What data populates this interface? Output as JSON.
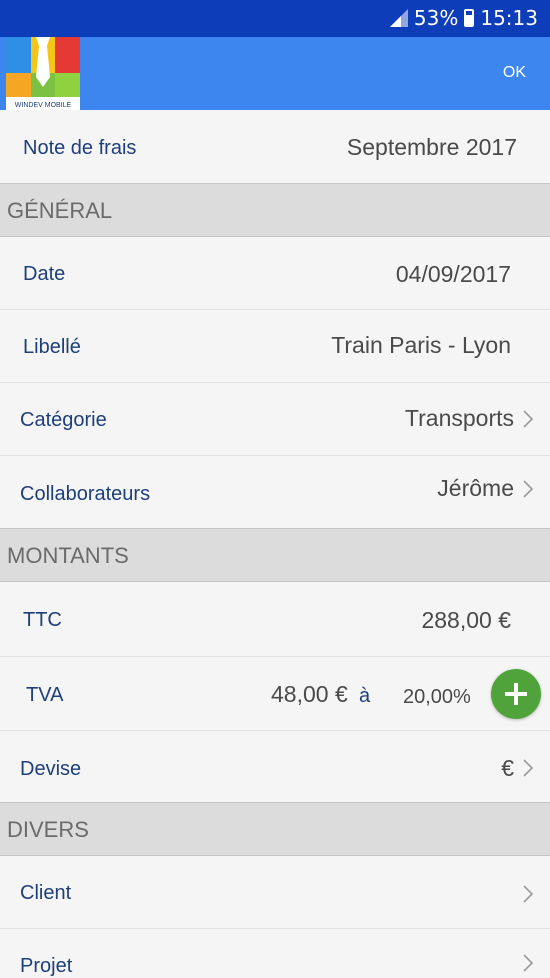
{
  "status_bar": {
    "battery_percent": "53%",
    "time": "15:13"
  },
  "app_bar": {
    "logo_caption": "WINDEV MOBILE",
    "ok_label": "OK"
  },
  "header_row": {
    "label": "Note de frais",
    "value": "Septembre 2017"
  },
  "sections": {
    "general": "GÉNÉRAL",
    "montants": "MONTANTS",
    "divers": "DIVERS"
  },
  "general": {
    "date": {
      "label": "Date",
      "value": "04/09/2017"
    },
    "libelle": {
      "label": "Libellé",
      "value": "Train Paris - Lyon"
    },
    "categorie": {
      "label": "Catégorie",
      "value": "Transports"
    },
    "collaborateurs": {
      "label": "Collaborateurs",
      "value": "Jérôme"
    }
  },
  "montants": {
    "ttc": {
      "label": "TTC",
      "value": "288,00 €"
    },
    "tva": {
      "label": "TVA",
      "amount": "48,00 €",
      "connector": "à",
      "rate": "20,00%"
    },
    "devise": {
      "label": "Devise",
      "value": "€"
    }
  },
  "divers": {
    "client": {
      "label": "Client"
    },
    "projet": {
      "label": "Projet"
    }
  },
  "colors": {
    "status_bar": "#0d3db8",
    "app_bar": "#3d86f0",
    "label": "#1d3f7a",
    "add_button": "#4fa33a"
  }
}
